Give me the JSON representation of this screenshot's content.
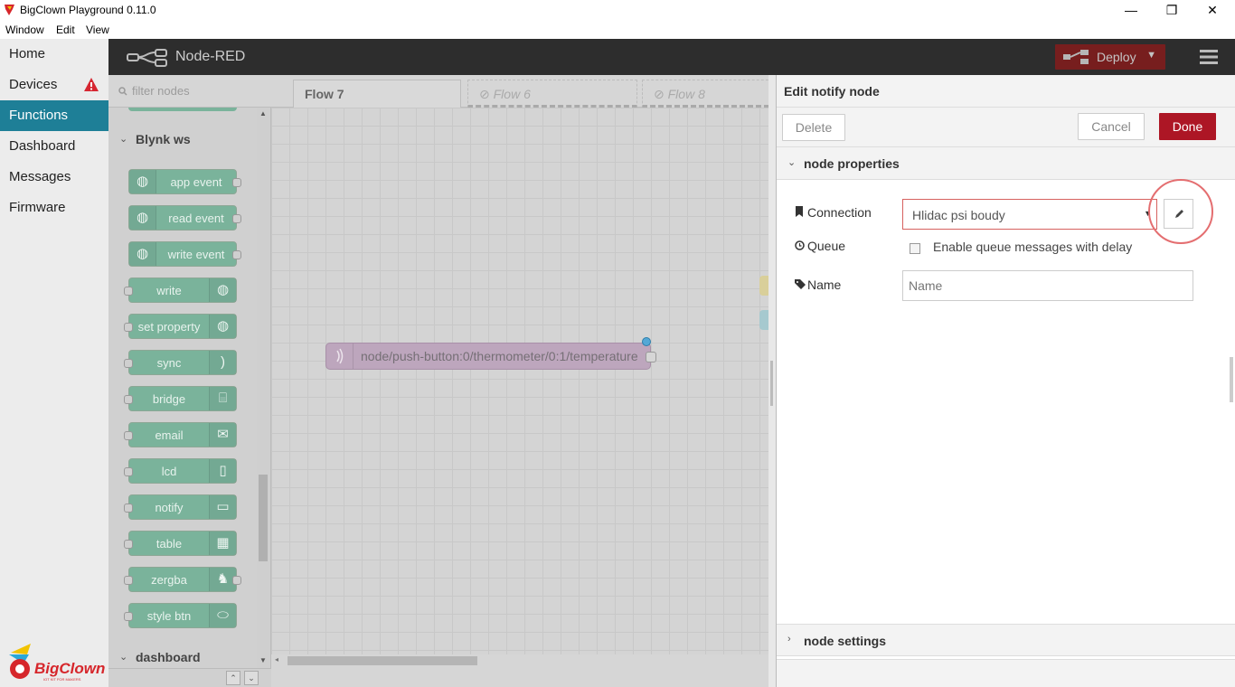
{
  "window": {
    "title": "BigClown Playground 0.11.0",
    "controls": {
      "minimize": "—",
      "restore": "❐",
      "close": "✕"
    }
  },
  "menubar": {
    "items": [
      "Window",
      "Edit",
      "View"
    ]
  },
  "app_nav": {
    "items": [
      {
        "label": "Home",
        "active": false
      },
      {
        "label": "Devices",
        "active": false,
        "warning": true
      },
      {
        "label": "Functions",
        "active": true
      },
      {
        "label": "Dashboard",
        "active": false
      },
      {
        "label": "Messages",
        "active": false
      },
      {
        "label": "Firmware",
        "active": false
      }
    ],
    "logo_text": "BigClown",
    "logo_tagline": "IOT KIT FOR MAKERS"
  },
  "nodered": {
    "brand": "Node-RED",
    "deploy_label": "Deploy",
    "colors": {
      "header": "#2d2d2d",
      "deploy": "#8c1a1a",
      "accent": "#1e7f97"
    }
  },
  "palette": {
    "filter_placeholder": "filter nodes",
    "categories": [
      "Blynk ws",
      "dashboard"
    ],
    "nodes": [
      {
        "label": "app event",
        "icon": "globe-icon",
        "side": "left"
      },
      {
        "label": "read event",
        "icon": "globe-icon",
        "side": "left"
      },
      {
        "label": "write event",
        "icon": "globe-icon",
        "side": "left"
      },
      {
        "label": "write",
        "icon": "globe-icon",
        "side": "right"
      },
      {
        "label": "set property",
        "icon": "globe-icon",
        "side": "right"
      },
      {
        "label": "sync",
        "icon": "wifi-icon",
        "side": "right"
      },
      {
        "label": "bridge",
        "icon": "bridge-icon",
        "side": "right"
      },
      {
        "label": "email",
        "icon": "envelope-icon",
        "side": "right"
      },
      {
        "label": "lcd",
        "icon": "lcd-icon",
        "side": "right"
      },
      {
        "label": "notify",
        "icon": "phone-notify-icon",
        "side": "right"
      },
      {
        "label": "table",
        "icon": "table-icon",
        "side": "right"
      },
      {
        "label": "zergba",
        "icon": "zergba-icon",
        "side": "right"
      },
      {
        "label": "style btn",
        "icon": "toggle-icon",
        "side": "right"
      }
    ]
  },
  "workspace": {
    "tabs": [
      {
        "label": "Flow 7",
        "active": true,
        "disabled": false
      },
      {
        "label": "Flow 6",
        "active": false,
        "disabled": true
      },
      {
        "label": "Flow 8",
        "active": false,
        "disabled": true
      }
    ],
    "node_label": "node/push-button:0/thermometer/0:1/temperature"
  },
  "tray": {
    "title": "Edit notify node",
    "delete_label": "Delete",
    "cancel_label": "Cancel",
    "done_label": "Done",
    "section_properties": "node properties",
    "section_settings": "node settings",
    "connection_label": "Connection",
    "connection_value": "Hlidac psi boudy",
    "queue_label": "Queue",
    "queue_checkbox_label": "Enable queue messages with delay",
    "queue_checked": false,
    "name_label": "Name",
    "name_value": "",
    "name_placeholder": "Name"
  }
}
